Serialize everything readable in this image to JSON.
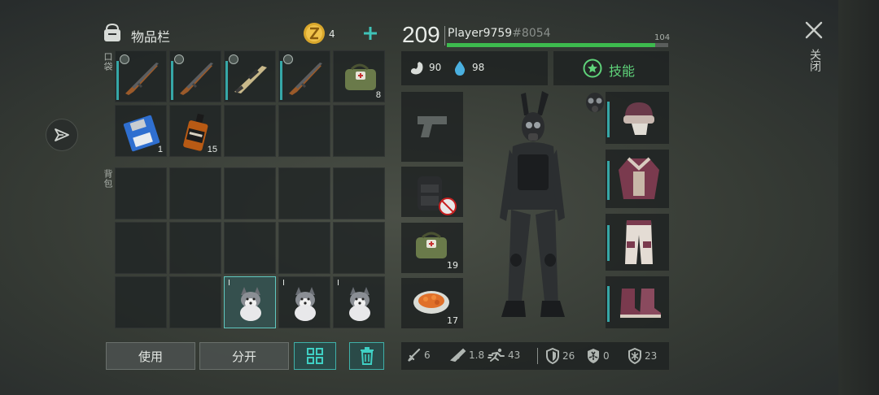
{
  "inventory": {
    "title": "物品栏",
    "coins": "4",
    "pocket_label": "口袋",
    "backpack_label": "背包",
    "pocket_counts": {
      "medkit": "8",
      "floppy": "1",
      "whiskey": "15"
    },
    "backpack_tiers": [
      "I",
      "I",
      "I"
    ]
  },
  "player": {
    "level": "209",
    "name": "Player9759",
    "tag": "#8054",
    "xp_value": "104",
    "xp_fraction": 0.94
  },
  "vitals": {
    "food": "90",
    "water": "98"
  },
  "skills_label": "技能",
  "gear_counts": {
    "medkit": "19",
    "food": "17"
  },
  "actions": {
    "use": "使用",
    "split": "分开"
  },
  "close_label": "关闭",
  "stats": {
    "melee": "6",
    "ranged": "1.8",
    "speed": "43",
    "armor": "26",
    "radiation": "0",
    "cold": "23"
  },
  "colors": {
    "accent": "#36a7a7",
    "xp": "#3dbb4e",
    "skills": "#5fd37a"
  }
}
